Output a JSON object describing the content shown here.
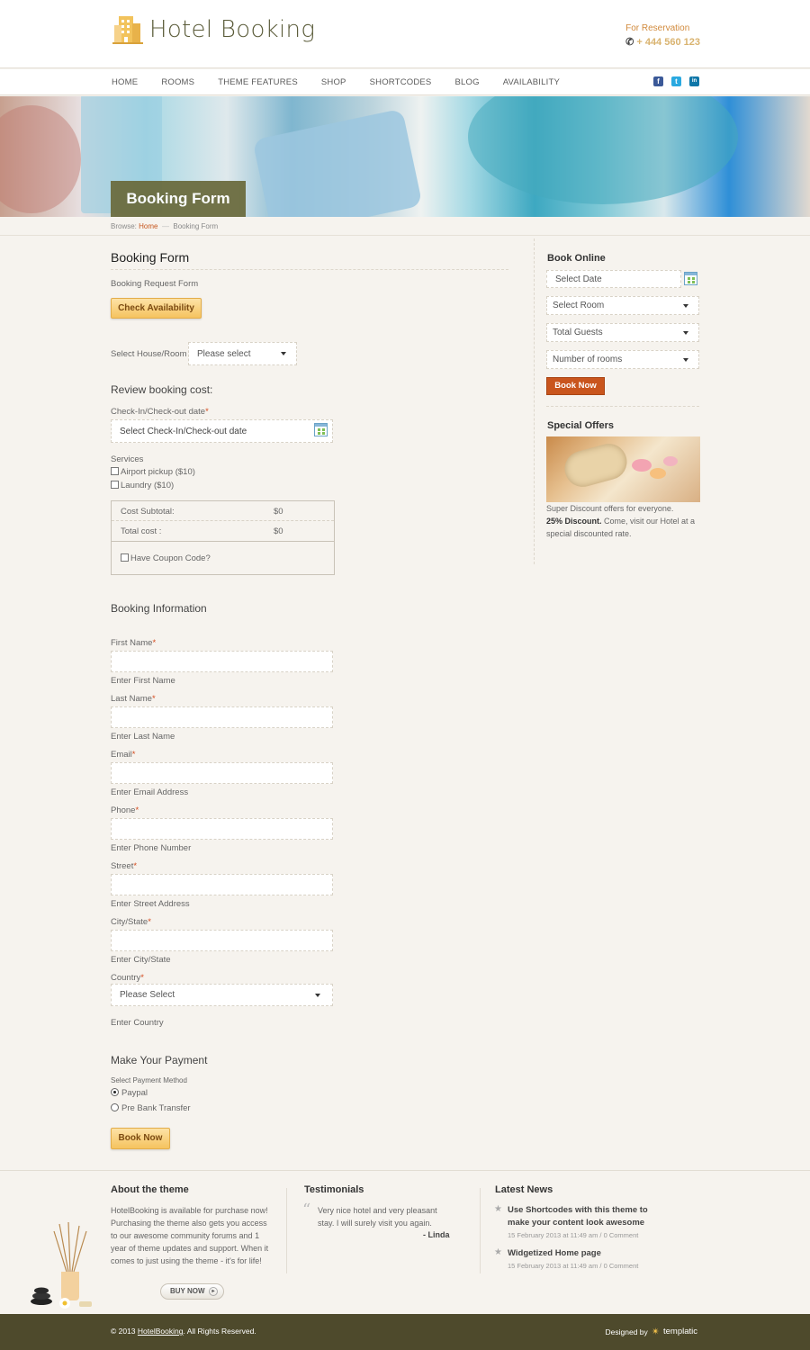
{
  "brand": {
    "name": "Hotel Booking",
    "reservation_label": "For Reservation",
    "phone": "+ 444 560 123"
  },
  "nav": {
    "items": [
      "HOME",
      "ROOMS",
      "THEME FEATURES",
      "SHOP",
      "SHORTCODES",
      "BLOG",
      "AVAILABILITY"
    ]
  },
  "social": [
    {
      "icon": "facebook-icon",
      "glyph": "f",
      "color": "#3b5998"
    },
    {
      "icon": "twitter-icon",
      "glyph": "t",
      "color": "#2aa9e0"
    },
    {
      "icon": "linkedin-icon",
      "glyph": "in",
      "color": "#0e76a8"
    }
  ],
  "banner": {
    "title": "Booking Form"
  },
  "breadcrumb": {
    "prefix": "Browse:",
    "home": "Home",
    "separator": "—",
    "current": "Booking Form"
  },
  "form": {
    "title": "Booking Form",
    "subtitle": "Booking Request Form",
    "check_availability": "Check Availability",
    "house_room_label": "Select House/Room",
    "house_room_value": "Please select",
    "review_heading": "Review booking cost:",
    "checkin_label": "Check-In/Check-out date",
    "checkin_placeholder": "Select Check-In/Check-out date",
    "services_label": "Services",
    "services": [
      "Airport pickup ($10)",
      "Laundry ($10)"
    ],
    "cost_subtotal_label": "Cost Subtotal:",
    "cost_subtotal_value": "$0",
    "total_cost_label": "Total cost :",
    "total_cost_value": "$0",
    "coupon_label": "Have Coupon Code?",
    "info_heading": "Booking Information",
    "fields": [
      {
        "label": "First Name",
        "help": "Enter First Name"
      },
      {
        "label": "Last Name",
        "help": "Enter Last Name"
      },
      {
        "label": "Email",
        "help": "Enter Email Address"
      },
      {
        "label": "Phone",
        "help": "Enter Phone Number"
      },
      {
        "label": "Street",
        "help": "Enter Street Address"
      },
      {
        "label": "City/State",
        "help": "Enter City/State"
      }
    ],
    "required_mark": "*",
    "country_label": "Country",
    "country_value": "Please Select",
    "country_help": "Enter Country",
    "payment_heading": "Make Your Payment",
    "payment_method_label": "Select Payment Method",
    "payment_options": [
      {
        "label": "Paypal",
        "selected": true
      },
      {
        "label": "Pre Bank Transfer",
        "selected": false
      }
    ],
    "book_now": "Book Now"
  },
  "sidebar": {
    "book_online_heading": "Book Online",
    "select_date": "Select Date",
    "select_room": "Select Room",
    "total_guests": "Total Guests",
    "number_of_rooms": "Number of rooms",
    "book_now": "Book Now",
    "offers_heading": "Special Offers",
    "offer_text_1": "Super Discount offers for everyone.",
    "offer_bold": "25% Discount.",
    "offer_text_2": " Come, visit our Hotel at a special discounted rate."
  },
  "footer": {
    "about_heading": "About the theme",
    "about_text": "HotelBooking is available for purchase now! Purchasing the theme also gets you access to our awesome community forums and 1 year of theme updates and support. When it comes to just using the theme - it's for life!",
    "buy_now": "BUY NOW",
    "testimonials_heading": "Testimonials",
    "testimonial_text": "Very nice hotel and very pleasant stay. I will surely visit you again.",
    "testimonial_author": "- Linda",
    "news_heading": "Latest News",
    "news": [
      {
        "title": "Use Shortcodes with this theme to make your content look awesome",
        "meta": "15 February 2013 at 11:49 am / 0 Comment"
      },
      {
        "title": "Widgetized Home page",
        "meta": "15 February 2013 at 11:49 am / 0 Comment"
      }
    ]
  },
  "copyright": {
    "prefix": "© 2013",
    "link": "HotelBooking",
    "suffix": ". All Rights Reserved.",
    "designed_by": "Designed by",
    "designer": "templatic"
  }
}
